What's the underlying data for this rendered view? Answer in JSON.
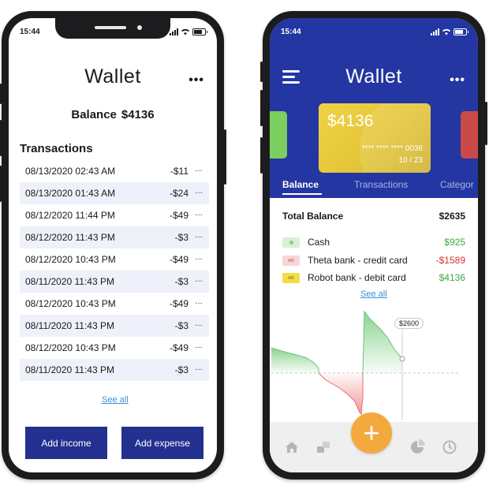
{
  "status_bar": {
    "time": "15:44"
  },
  "left": {
    "title": "Wallet",
    "more": "•••",
    "balance_label": "Balance",
    "balance_value": "$4136",
    "transactions_heading": "Transactions",
    "transactions": [
      {
        "date": "08/13/2020 02:43 AM",
        "amount": "-$11"
      },
      {
        "date": "08/13/2020 01:43 AM",
        "amount": "-$24"
      },
      {
        "date": "08/12/2020 11:44 PM",
        "amount": "-$49"
      },
      {
        "date": "08/12/2020 11:43 PM",
        "amount": "-$3"
      },
      {
        "date": "08/12/2020 10:43 PM",
        "amount": "-$49"
      },
      {
        "date": "08/11/2020 11:43 PM",
        "amount": "-$3"
      },
      {
        "date": "08/12/2020 10:43 PM",
        "amount": "-$49"
      },
      {
        "date": "08/11/2020 11:43 PM",
        "amount": "-$3"
      },
      {
        "date": "08/12/2020 10:43 PM",
        "amount": "-$49"
      },
      {
        "date": "08/11/2020 11:43 PM",
        "amount": "-$3"
      }
    ],
    "row_menu": "…",
    "see_all": "See all",
    "add_income": "Add income",
    "add_expense": "Add expense"
  },
  "right": {
    "title": "Wallet",
    "more": "•••",
    "card": {
      "amount": "$4136",
      "number": "**** **** **** 0036",
      "expiry": "10 / 23"
    },
    "tabs": [
      "Balance",
      "Transactions",
      "Categor"
    ],
    "total_label": "Total Balance",
    "total_value": "$2635",
    "accounts": [
      {
        "name": "Cash",
        "value": "$925",
        "color": "#3aa845",
        "icon_bg": "#d9efd6",
        "icon_fg": "#86cf7f"
      },
      {
        "name": "Theta bank - credit card",
        "value": "-$1589",
        "color": "#d6332f",
        "icon_bg": "#f6d6d6",
        "icon_fg": "#e89a9a"
      },
      {
        "name": "Robot bank - debit card",
        "value": "$4136",
        "color": "#3aa845",
        "icon_bg": "#f2dc4c",
        "icon_fg": "#c9ac22"
      }
    ],
    "see_all": "See all",
    "chart_marker": "$2600",
    "fab": "+"
  },
  "colors": {
    "primary": "#23308f",
    "header": "#2336a1",
    "accent": "#f4a93f",
    "positive": "#3aa845",
    "negative": "#d6332f"
  }
}
